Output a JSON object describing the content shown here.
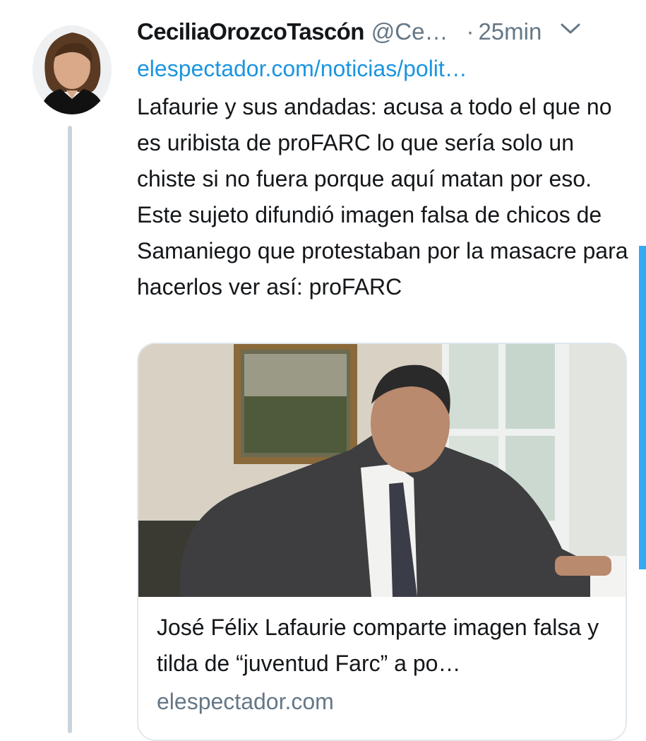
{
  "tweet": {
    "display_name": "CeciliaOrozcoTascón",
    "handle": "@Ce…",
    "separator": "·",
    "time": "25min",
    "link_text": "elespectador.com/noticias/polit…",
    "text": "Lafaurie y sus andadas: acusa a todo el que no es uribista de proFARC lo que sería solo un chiste si no fuera porque aquí matan por eso. Este sujeto difundió imagen falsa de chicos de Samaniego que protestaban por la masacre para hacerlos ver así: proFARC"
  },
  "card": {
    "title": "José Félix Lafaurie comparte imagen falsa y tilda de “juventud Farc” a po…",
    "domain": "elespectador.com"
  },
  "icons": {
    "more": "chevron-down-icon",
    "avatar": "avatar-photo"
  },
  "colors": {
    "link": "#1b95e0",
    "secondary_text": "#657786",
    "thread_line": "#c9d3dc",
    "scroll_accent": "#1da1f2"
  }
}
